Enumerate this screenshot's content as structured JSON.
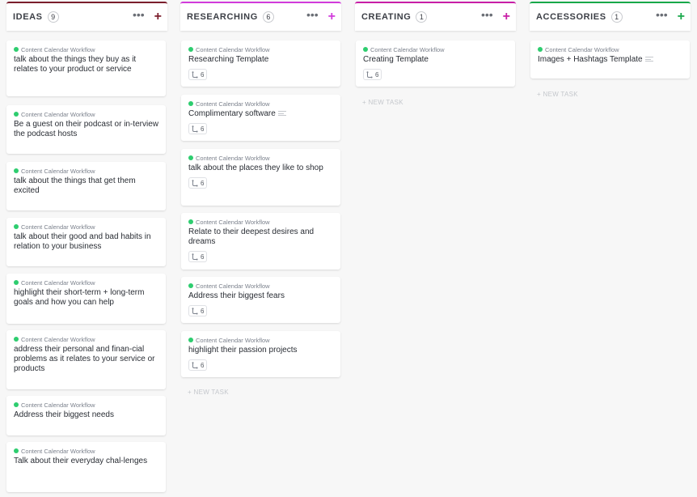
{
  "card_meta_label": "Content Calendar Workflow",
  "columns": [
    {
      "title": "IDEAS",
      "count": "9",
      "accent": "#7b1e2c",
      "cards": [
        {
          "title": "talk about the things they buy as it relates to your product or service"
        },
        {
          "title": "Be a guest on their podcast or in-terview the podcast hosts"
        },
        {
          "title": "talk about the things that get them excited"
        },
        {
          "title": "talk about their good and bad habits in relation to your business"
        },
        {
          "title": "highlight their short-term + long-term goals and how you can help"
        },
        {
          "title": "address their personal and finan-cial problems as it relates to your service or products"
        },
        {
          "title": "Address their biggest needs"
        },
        {
          "title": "Talk about their everyday chal-lenges"
        }
      ]
    },
    {
      "title": "RESEARCHING",
      "count": "6",
      "accent": "#d13adb",
      "new_task": "+ NEW TASK",
      "cards": [
        {
          "title": "Researching Template",
          "subtasks": "6"
        },
        {
          "title": "Complimentary software",
          "subtasks": "6",
          "has_description": true
        },
        {
          "title": "talk about the places they like to shop",
          "subtasks": "6"
        },
        {
          "title": "Relate to their deepest desires and dreams",
          "subtasks": "6"
        },
        {
          "title": "Address their biggest fears",
          "subtasks": "6"
        },
        {
          "title": "highlight their passion projects",
          "subtasks": "6"
        }
      ]
    },
    {
      "title": "CREATING",
      "count": "1",
      "accent": "#c81ea6",
      "new_task": "+ NEW TASK",
      "cards": [
        {
          "title": "Creating Template",
          "subtasks": "6"
        }
      ]
    },
    {
      "title": "ACCESSORIES",
      "count": "1",
      "accent": "#18a84a",
      "new_task": "+ NEW TASK",
      "cards": [
        {
          "title": "Images + Hashtags Template",
          "has_description": true
        }
      ]
    }
  ]
}
